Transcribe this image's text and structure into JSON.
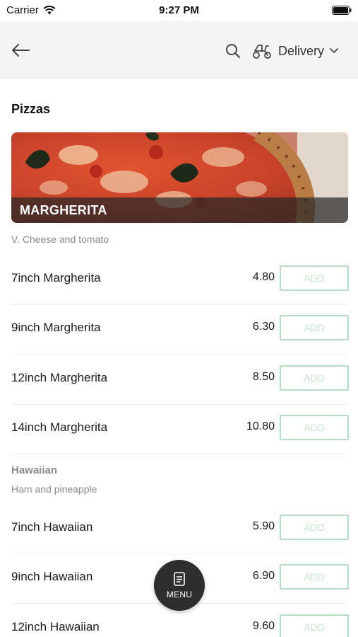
{
  "status_bar": {
    "carrier": "Carrier",
    "time": "9:27 PM"
  },
  "header": {
    "back_icon": "arrow-left-icon",
    "search_icon": "search-icon",
    "delivery_icon": "scooter-icon",
    "delivery_label": "Delivery",
    "dropdown_icon": "chevron-down-icon"
  },
  "section": {
    "title": "Pizzas",
    "hero_caption": "MARGHERITA",
    "description": "V. Cheese and tomato"
  },
  "margherita_items": [
    {
      "name": "7inch Margherita",
      "price": "4.80",
      "add_label": "ADD"
    },
    {
      "name": "9inch Margherita",
      "price": "6.30",
      "add_label": "ADD"
    },
    {
      "name": "12inch Margherita",
      "price": "8.50",
      "add_label": "ADD"
    },
    {
      "name": "14inch Margherita",
      "price": "10.80",
      "add_label": "ADD"
    }
  ],
  "hawaiian": {
    "heading": "Hawaiian",
    "description": "Ham and pineapple",
    "items": [
      {
        "name": "7inch Hawaiian",
        "price": "5.90",
        "add_label": "ADD"
      },
      {
        "name": "9inch Hawaiian",
        "price": "6.90",
        "add_label": "ADD"
      },
      {
        "name": "12inch Hawaiian",
        "price": "9.60",
        "add_label": "ADD"
      }
    ]
  },
  "menu_button": {
    "label": "MENU",
    "icon": "menu-card-icon"
  },
  "colors": {
    "header_bg": "#f4f4f4",
    "add_border": "#b7ddc4",
    "add_text": "#c6e4cf",
    "fab_bg": "#2e2e2e"
  }
}
